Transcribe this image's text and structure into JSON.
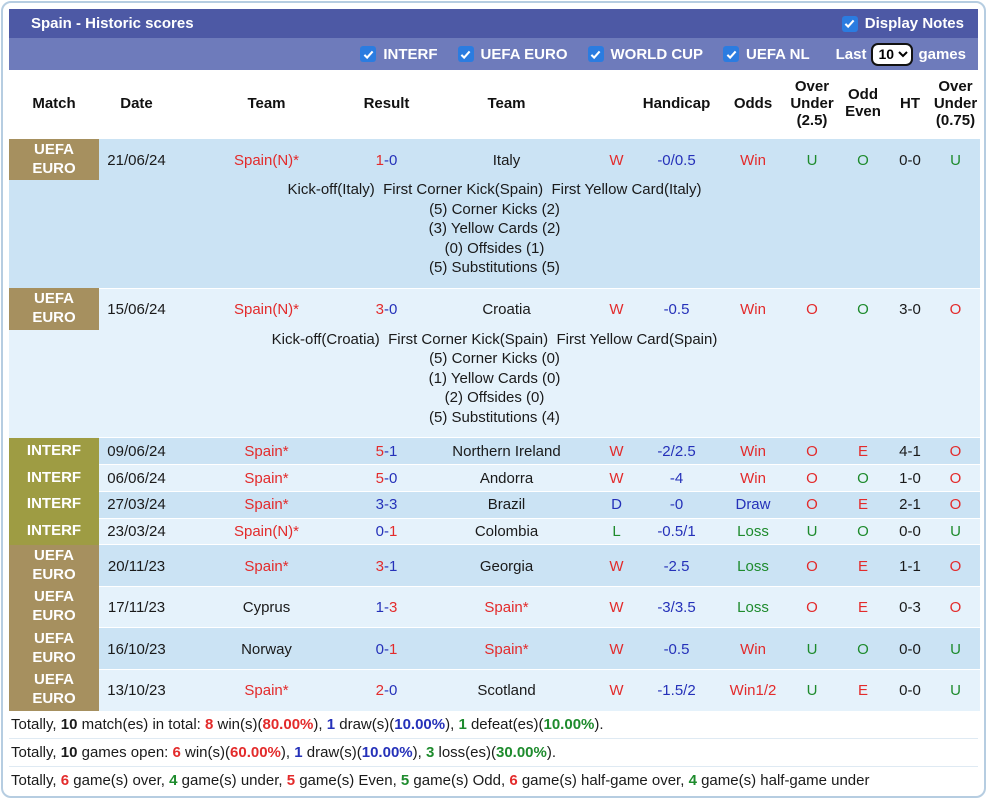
{
  "title_bar": {
    "title": "Spain - Historic scores",
    "display_notes_label": "Display Notes",
    "display_notes_checked": true
  },
  "filter_bar": {
    "filters": [
      {
        "label": "INTERF",
        "checked": true
      },
      {
        "label": "UEFA EURO",
        "checked": true
      },
      {
        "label": "WORLD CUP",
        "checked": true
      },
      {
        "label": "UEFA NL",
        "checked": true
      }
    ],
    "last_label": "Last",
    "last_value": "10",
    "games_label": "games"
  },
  "colors": {
    "title_bar": "#4d59a5",
    "filter_bar": "#6e7bbb",
    "checkbox_blue": "#2b7ce0",
    "badge_euro": "#a6905f",
    "badge_interf": "#9e9c43",
    "band_dark": "#cbe3f4",
    "band_light": "#e5f2fb",
    "win_red": "#e32b2b",
    "draw_blue": "#2531b9",
    "loss_green": "#1e8b2d"
  },
  "table": {
    "columns": [
      "Match",
      "Date",
      "Team",
      "Result",
      "Team",
      "",
      "Handicap",
      "Odds",
      "Over\nUnder\n(2.5)",
      "Odd\nEven",
      "HT",
      "Over\nUnder\n(0.75)"
    ],
    "rows": [
      {
        "competition": "UEFA EURO",
        "badge": "euro",
        "band": "dark",
        "date": [
          [
            "21/06/24",
            "black"
          ]
        ],
        "home": [
          [
            "Spain(N)*",
            "red"
          ]
        ],
        "score": [
          [
            "1",
            "red"
          ],
          [
            "-0",
            "blue"
          ]
        ],
        "away": [
          [
            "Italy",
            "black"
          ]
        ],
        "wdl": [
          [
            "W",
            "red"
          ]
        ],
        "handicap": [
          [
            "-0/0.5",
            "blue"
          ]
        ],
        "odds": [
          [
            "Win",
            "red"
          ]
        ],
        "ou25": [
          [
            "U",
            "green"
          ]
        ],
        "odd_even": [
          [
            "O",
            "green"
          ]
        ],
        "ht": [
          [
            "0-0",
            "black"
          ]
        ],
        "ou075": [
          [
            "U",
            "green"
          ]
        ],
        "notes": [
          "Kick-off(Italy)  First Corner Kick(Spain)  First Yellow Card(Italy)",
          "(5) Corner Kicks (2)",
          "(3) Yellow Cards (2)",
          "(0) Offsides (1)",
          "(5) Substitutions (5)"
        ]
      },
      {
        "competition": "UEFA EURO",
        "badge": "euro",
        "band": "light",
        "date": [
          [
            "15/06/24",
            "black"
          ]
        ],
        "home": [
          [
            "Spain(N)*",
            "red"
          ]
        ],
        "score": [
          [
            "3",
            "red"
          ],
          [
            "-0",
            "blue"
          ]
        ],
        "away": [
          [
            "Croatia",
            "black"
          ]
        ],
        "wdl": [
          [
            "W",
            "red"
          ]
        ],
        "handicap": [
          [
            "-0.5",
            "blue"
          ]
        ],
        "odds": [
          [
            "Win",
            "red"
          ]
        ],
        "ou25": [
          [
            "O",
            "red"
          ]
        ],
        "odd_even": [
          [
            "O",
            "green"
          ]
        ],
        "ht": [
          [
            "3-0",
            "black"
          ]
        ],
        "ou075": [
          [
            "O",
            "red"
          ]
        ],
        "notes": [
          "Kick-off(Croatia)  First Corner Kick(Spain)  First Yellow Card(Spain)",
          "(5) Corner Kicks (0)",
          "(1) Yellow Cards (0)",
          "(2) Offsides (0)",
          "(5) Substitutions (4)"
        ]
      },
      {
        "competition": "INTERF",
        "badge": "interf",
        "band": "dark",
        "date": [
          [
            "09/06/24",
            "black"
          ]
        ],
        "home": [
          [
            "Spain*",
            "red"
          ]
        ],
        "score": [
          [
            "5",
            "red"
          ],
          [
            "-1",
            "blue"
          ]
        ],
        "away": [
          [
            "Northern Ireland",
            "black"
          ]
        ],
        "wdl": [
          [
            "W",
            "red"
          ]
        ],
        "handicap": [
          [
            "-2/2.5",
            "blue"
          ]
        ],
        "odds": [
          [
            "Win",
            "red"
          ]
        ],
        "ou25": [
          [
            "O",
            "red"
          ]
        ],
        "odd_even": [
          [
            "E",
            "red"
          ]
        ],
        "ht": [
          [
            "4-1",
            "black"
          ]
        ],
        "ou075": [
          [
            "O",
            "red"
          ]
        ]
      },
      {
        "competition": "INTERF",
        "badge": "interf",
        "band": "light",
        "date": [
          [
            "06/06/24",
            "black"
          ]
        ],
        "home": [
          [
            "Spain*",
            "red"
          ]
        ],
        "score": [
          [
            "5",
            "red"
          ],
          [
            "-0",
            "blue"
          ]
        ],
        "away": [
          [
            "Andorra",
            "black"
          ]
        ],
        "wdl": [
          [
            "W",
            "red"
          ]
        ],
        "handicap": [
          [
            "-4",
            "blue"
          ]
        ],
        "odds": [
          [
            "Win",
            "red"
          ]
        ],
        "ou25": [
          [
            "O",
            "red"
          ]
        ],
        "odd_even": [
          [
            "O",
            "green"
          ]
        ],
        "ht": [
          [
            "1-0",
            "black"
          ]
        ],
        "ou075": [
          [
            "O",
            "red"
          ]
        ]
      },
      {
        "competition": "INTERF",
        "badge": "interf",
        "band": "dark",
        "date": [
          [
            "27/03/24",
            "black"
          ]
        ],
        "home": [
          [
            "Spain*",
            "red"
          ]
        ],
        "score": [
          [
            "3-3",
            "blue"
          ]
        ],
        "away": [
          [
            "Brazil",
            "black"
          ]
        ],
        "wdl": [
          [
            "D",
            "blue"
          ]
        ],
        "handicap": [
          [
            "-0",
            "blue"
          ]
        ],
        "odds": [
          [
            "Draw",
            "blue"
          ]
        ],
        "ou25": [
          [
            "O",
            "red"
          ]
        ],
        "odd_even": [
          [
            "E",
            "red"
          ]
        ],
        "ht": [
          [
            "2-1",
            "black"
          ]
        ],
        "ou075": [
          [
            "O",
            "red"
          ]
        ]
      },
      {
        "competition": "INTERF",
        "badge": "interf",
        "band": "light",
        "date": [
          [
            "23/03/24",
            "black"
          ]
        ],
        "home": [
          [
            "Spain(N)*",
            "red"
          ]
        ],
        "score": [
          [
            "0-",
            "blue"
          ],
          [
            "1",
            "red"
          ]
        ],
        "away": [
          [
            "Colombia",
            "black"
          ]
        ],
        "wdl": [
          [
            "L",
            "green"
          ]
        ],
        "handicap": [
          [
            "-0.5/1",
            "blue"
          ]
        ],
        "odds": [
          [
            "Loss",
            "green"
          ]
        ],
        "ou25": [
          [
            "U",
            "green"
          ]
        ],
        "odd_even": [
          [
            "O",
            "green"
          ]
        ],
        "ht": [
          [
            "0-0",
            "black"
          ]
        ],
        "ou075": [
          [
            "U",
            "green"
          ]
        ]
      },
      {
        "competition": "UEFA EURO",
        "badge": "euro",
        "band": "dark",
        "date": [
          [
            "20/11/23",
            "black"
          ]
        ],
        "home": [
          [
            "Spain*",
            "red"
          ]
        ],
        "score": [
          [
            "3",
            "red"
          ],
          [
            "-1",
            "blue"
          ]
        ],
        "away": [
          [
            "Georgia",
            "black"
          ]
        ],
        "wdl": [
          [
            "W",
            "red"
          ]
        ],
        "handicap": [
          [
            "-2.5",
            "blue"
          ]
        ],
        "odds": [
          [
            "Loss",
            "green"
          ]
        ],
        "ou25": [
          [
            "O",
            "red"
          ]
        ],
        "odd_even": [
          [
            "E",
            "red"
          ]
        ],
        "ht": [
          [
            "1-1",
            "black"
          ]
        ],
        "ou075": [
          [
            "O",
            "red"
          ]
        ]
      },
      {
        "competition": "UEFA EURO",
        "badge": "euro",
        "band": "light",
        "date": [
          [
            "17/11/23",
            "black"
          ]
        ],
        "home": [
          [
            "Cyprus",
            "black"
          ]
        ],
        "score": [
          [
            "1-",
            "blue"
          ],
          [
            "3",
            "red"
          ]
        ],
        "away": [
          [
            "Spain*",
            "red"
          ]
        ],
        "wdl": [
          [
            "W",
            "red"
          ]
        ],
        "handicap": [
          [
            "-3/3.5",
            "blue"
          ]
        ],
        "odds": [
          [
            "Loss",
            "green"
          ]
        ],
        "ou25": [
          [
            "O",
            "red"
          ]
        ],
        "odd_even": [
          [
            "E",
            "red"
          ]
        ],
        "ht": [
          [
            "0-3",
            "black"
          ]
        ],
        "ou075": [
          [
            "O",
            "red"
          ]
        ]
      },
      {
        "competition": "UEFA EURO",
        "badge": "euro",
        "band": "dark",
        "date": [
          [
            "16/10/23",
            "black"
          ]
        ],
        "home": [
          [
            "Norway",
            "black"
          ]
        ],
        "score": [
          [
            "0-",
            "blue"
          ],
          [
            "1",
            "red"
          ]
        ],
        "away": [
          [
            "Spain*",
            "red"
          ]
        ],
        "wdl": [
          [
            "W",
            "red"
          ]
        ],
        "handicap": [
          [
            "-0.5",
            "blue"
          ]
        ],
        "odds": [
          [
            "Win",
            "red"
          ]
        ],
        "ou25": [
          [
            "U",
            "green"
          ]
        ],
        "odd_even": [
          [
            "O",
            "green"
          ]
        ],
        "ht": [
          [
            "0-0",
            "black"
          ]
        ],
        "ou075": [
          [
            "U",
            "green"
          ]
        ]
      },
      {
        "competition": "UEFA EURO",
        "badge": "euro",
        "band": "light",
        "date": [
          [
            "13/10/23",
            "black"
          ]
        ],
        "home": [
          [
            "Spain*",
            "red"
          ]
        ],
        "score": [
          [
            "2",
            "red"
          ],
          [
            "-0",
            "blue"
          ]
        ],
        "away": [
          [
            "Scotland",
            "black"
          ]
        ],
        "wdl": [
          [
            "W",
            "red"
          ]
        ],
        "handicap": [
          [
            "-1.5/2",
            "blue"
          ]
        ],
        "odds": [
          [
            "Win1/2",
            "red"
          ]
        ],
        "ou25": [
          [
            "U",
            "green"
          ]
        ],
        "odd_even": [
          [
            "E",
            "red"
          ]
        ],
        "ht": [
          [
            "0-0",
            "black"
          ]
        ],
        "ou075": [
          [
            "U",
            "green"
          ]
        ]
      }
    ]
  },
  "footer": {
    "lines": [
      {
        "parts": [
          [
            "Totally, ",
            "n"
          ],
          [
            "10",
            "bb"
          ],
          [
            " match(es) in total: ",
            "n"
          ],
          [
            "8",
            "rb"
          ],
          [
            " win(s)(",
            "n"
          ],
          [
            "80.00%",
            "rb"
          ],
          [
            "), ",
            "n"
          ],
          [
            "1",
            "lb"
          ],
          [
            " draw(s)(",
            "n"
          ],
          [
            "10.00%",
            "lb"
          ],
          [
            "), ",
            "n"
          ],
          [
            "1",
            "gb"
          ],
          [
            " defeat(es)(",
            "n"
          ],
          [
            "10.00%",
            "gb"
          ],
          [
            ").",
            "n"
          ]
        ]
      },
      {
        "parts": [
          [
            "Totally, ",
            "n"
          ],
          [
            "10",
            "bb"
          ],
          [
            " games open: ",
            "n"
          ],
          [
            "6",
            "rb"
          ],
          [
            " win(s)(",
            "n"
          ],
          [
            "60.00%",
            "rb"
          ],
          [
            "), ",
            "n"
          ],
          [
            "1",
            "lb"
          ],
          [
            " draw(s)(",
            "n"
          ],
          [
            "10.00%",
            "lb"
          ],
          [
            "), ",
            "n"
          ],
          [
            "3",
            "gb"
          ],
          [
            " loss(es)(",
            "n"
          ],
          [
            "30.00%",
            "gb"
          ],
          [
            ").",
            "n"
          ]
        ]
      },
      {
        "parts": [
          [
            "Totally, ",
            "n"
          ],
          [
            "6",
            "rb"
          ],
          [
            " game(s) over, ",
            "n"
          ],
          [
            "4",
            "gb"
          ],
          [
            " game(s) under, ",
            "n"
          ],
          [
            "5",
            "rb"
          ],
          [
            " game(s) Even, ",
            "n"
          ],
          [
            "5",
            "gb"
          ],
          [
            " game(s) Odd, ",
            "n"
          ],
          [
            "6",
            "rb"
          ],
          [
            " game(s) half-game over, ",
            "n"
          ],
          [
            "4",
            "gb"
          ],
          [
            " game(s) half-game under",
            "n"
          ]
        ]
      }
    ]
  }
}
